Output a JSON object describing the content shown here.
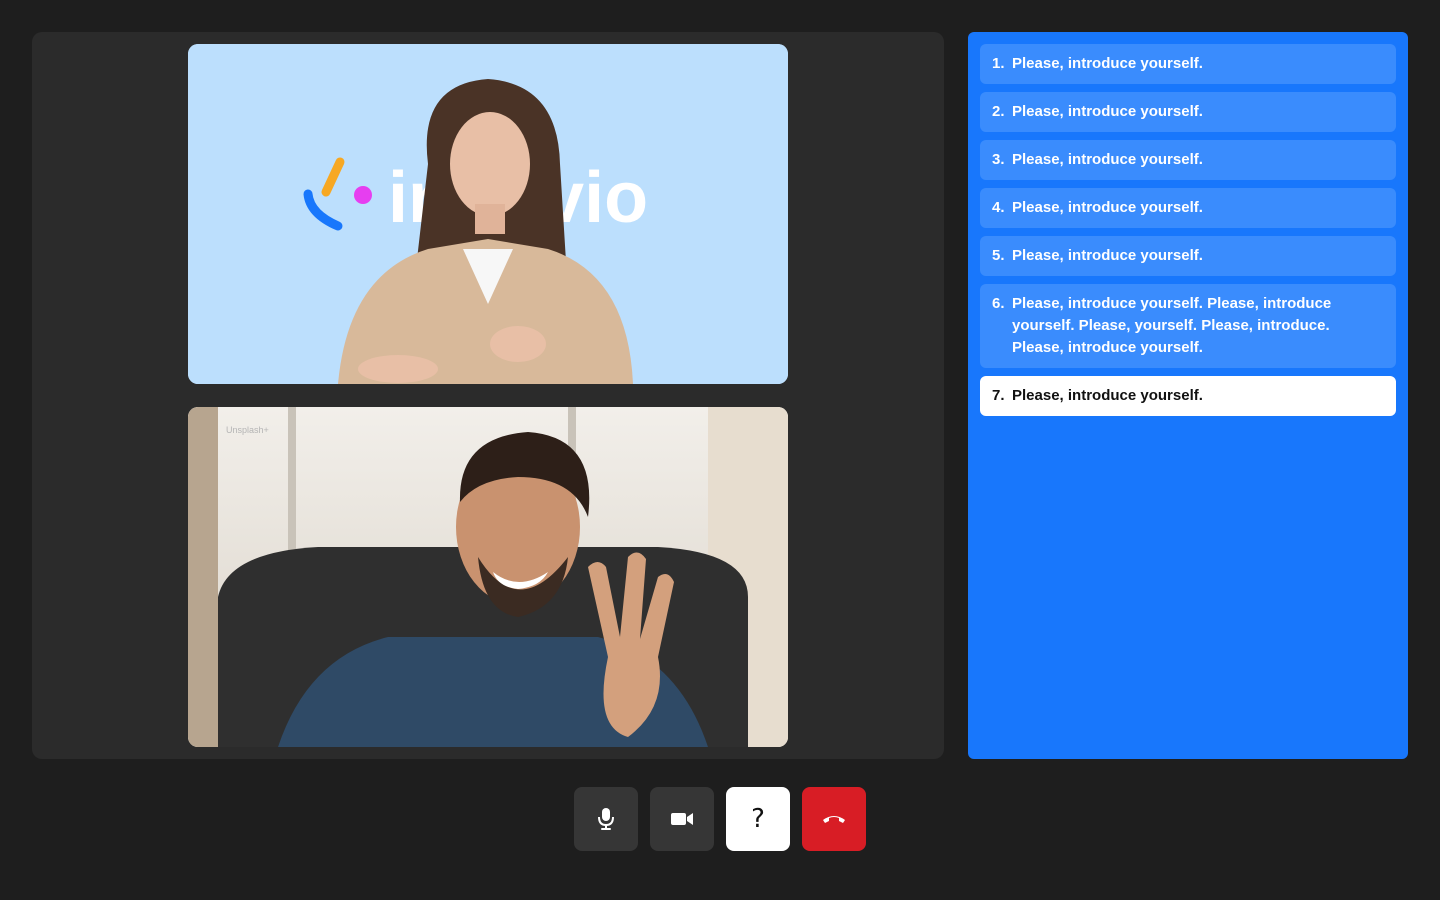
{
  "video": {
    "interviewer_logo_text": "intervio",
    "participant_watermark": "Unsplash+"
  },
  "questions": [
    {
      "num": "1.",
      "text": "Please, introduce yourself.",
      "active": false
    },
    {
      "num": "2.",
      "text": "Please, introduce yourself.",
      "active": false
    },
    {
      "num": "3.",
      "text": "Please, introduce yourself.",
      "active": false
    },
    {
      "num": "4.",
      "text": "Please, introduce yourself.",
      "active": false
    },
    {
      "num": "5.",
      "text": "Please, introduce yourself.",
      "active": false
    },
    {
      "num": "6.",
      "text": "Please, introduce yourself. Please, introduce yourself. Please, yourself. Please, introduce. Please, introduce yourself.",
      "active": false
    },
    {
      "num": "7.",
      "text": "Please, introduce yourself.",
      "active": true
    }
  ],
  "controls": {
    "mic_icon": "microphone-icon",
    "camera_icon": "video-camera-icon",
    "help_label": "?",
    "hangup_icon": "phone-hangup-icon"
  },
  "colors": {
    "background": "#1e1e1e",
    "panel": "#2b2b2b",
    "accent": "#1877fc",
    "question_item": "#3a8cfd",
    "hangup": "#d81d25"
  }
}
